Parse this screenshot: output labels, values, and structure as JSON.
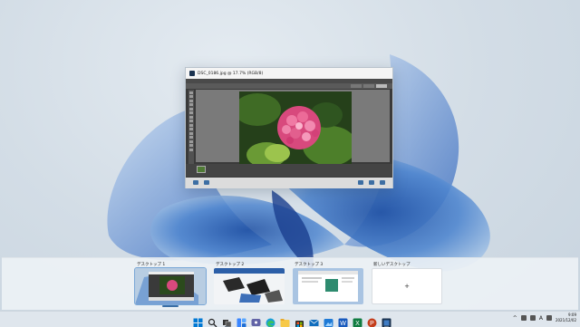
{
  "window": {
    "title": "DSC_0186.jpg @ 17.7% (RGB/8)",
    "app_icon": "photoshop-elements-icon",
    "workspace_tabs": [
      "tab-1",
      "tab-2",
      "tab-3"
    ],
    "content": "photo of pink hydrangea with green leaves"
  },
  "task_view": {
    "desktops": [
      {
        "label": "デスクトップ 1",
        "active": true
      },
      {
        "label": "デスクトップ 2",
        "active": false
      },
      {
        "label": "デスクトップ 3",
        "active": false
      }
    ],
    "new_desktop": {
      "label": "新しいデスクトップ",
      "symbol": "+"
    }
  },
  "taskbar": {
    "icons": [
      "start-icon",
      "search-icon",
      "task-view-icon",
      "widgets-icon",
      "chat-icon",
      "edge-icon",
      "file-explorer-icon",
      "store-icon",
      "mail-icon",
      "photos-icon",
      "word-icon",
      "excel-icon",
      "powerpoint-icon",
      "photoshop-elements-icon"
    ],
    "tray": {
      "chevron": "^",
      "ime": "A",
      "time": "9:09",
      "date": "2021/12/02"
    }
  },
  "colors": {
    "accent": "#3a6ea5",
    "wallpaper": "#d6e0e9",
    "bloom": "#3c6fb8"
  }
}
